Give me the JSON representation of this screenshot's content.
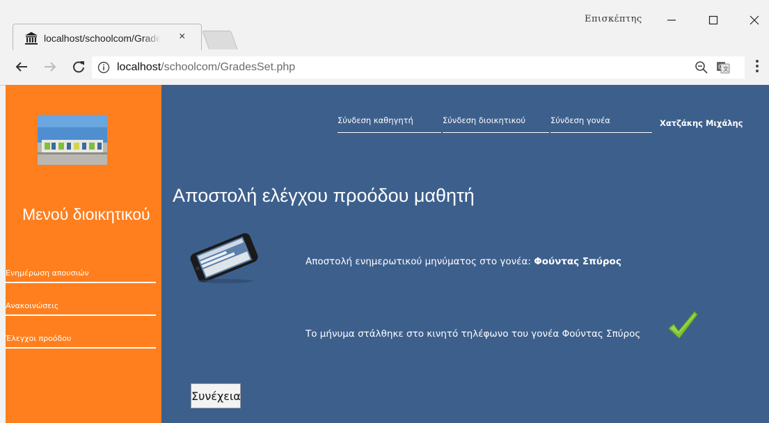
{
  "browser": {
    "tab_title": "localhost/schoolcom/GradesSet.php",
    "tab_close": "×",
    "profile_label": "Επισκέπτης",
    "url_host": "localhost",
    "url_path": "/schoolcom/GradesSet.php"
  },
  "sidebar": {
    "heading": "Μενού διοικητικού",
    "items": [
      {
        "label": "Ενημέρωση απουσιών"
      },
      {
        "label": "Ανακοινώσεις"
      },
      {
        "label": "Έλεγχοι προόδου"
      }
    ],
    "colors": {
      "background": "#ff7f1e"
    }
  },
  "topnav": {
    "items": [
      {
        "label": "Σύνδεση καθηγητή"
      },
      {
        "label": "Σύνδεση διοικητικού"
      },
      {
        "label": "Σύνδεση γονέα"
      }
    ],
    "user": "Χατζάκης Μιχάλης"
  },
  "main": {
    "title": "Αποστολή ελέγχου προόδου μαθητή",
    "message_prefix": "Αποστολή ενημερωτικού μηνύματος στο γονέα: ",
    "parent_name": "Φούντας Σπύρος",
    "sent_message": "Το μήνυμα στάλθηκε στο κινητό τηλέφωνο του γονέα Φούντας Σπύρος",
    "continue_label": "Συνέχεια",
    "colors": {
      "background": "#3d5f8c",
      "success": "#7cc232"
    }
  }
}
